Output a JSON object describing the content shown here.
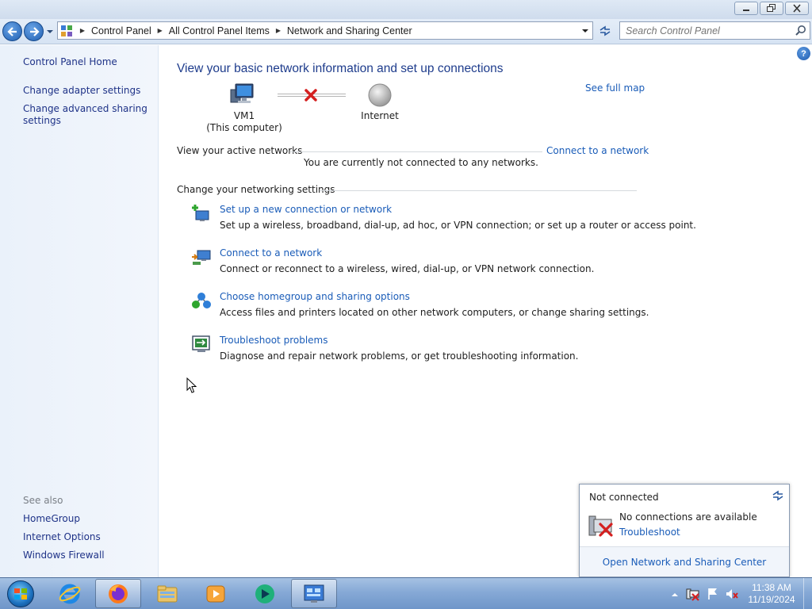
{
  "window": {
    "minimize_label": "—",
    "maximize_label": "❐",
    "close_label": "✕"
  },
  "address": {
    "crumbs": [
      "Control Panel",
      "All Control Panel Items",
      "Network and Sharing Center"
    ],
    "icons": {
      "back": "back-arrow-icon",
      "forward": "forward-arrow-icon",
      "refresh": "refresh-icon",
      "search": "search-icon"
    }
  },
  "search": {
    "placeholder": "Search Control Panel"
  },
  "sidebar": {
    "home": "Control Panel Home",
    "items": [
      "Change adapter settings",
      "Change advanced sharing settings"
    ],
    "see_also_label": "See also",
    "see_also": [
      "HomeGroup",
      "Internet Options",
      "Windows Firewall"
    ]
  },
  "help_label": "?",
  "main": {
    "title": "View your basic network information and set up connections",
    "see_full_map": "See full map",
    "network_map": {
      "computer_name": "VM1",
      "computer_sub": "(This computer)",
      "internet": "Internet",
      "status": "disconnected"
    },
    "active_networks": {
      "heading": "View your active networks",
      "connect_link": "Connect to a network",
      "message": "You are currently not connected to any networks."
    },
    "settings": {
      "heading": "Change your networking settings",
      "tasks": [
        {
          "link": "Set up a new connection or network",
          "desc": "Set up a wireless, broadband, dial-up, ad hoc, or VPN connection; or set up a router or access point.",
          "icon": "new-connection-icon"
        },
        {
          "link": "Connect to a network",
          "desc": "Connect or reconnect to a wireless, wired, dial-up, or VPN network connection.",
          "icon": "connect-network-icon"
        },
        {
          "link": "Choose homegroup and sharing options",
          "desc": "Access files and printers located on other network computers, or change sharing settings.",
          "icon": "homegroup-icon"
        },
        {
          "link": "Troubleshoot problems",
          "desc": "Diagnose and repair network problems, or get troubleshooting information.",
          "icon": "troubleshoot-icon"
        }
      ]
    }
  },
  "flyout": {
    "title": "Not connected",
    "no_connections": "No connections are available",
    "troubleshoot": "Troubleshoot",
    "open_center": "Open Network and Sharing Center"
  },
  "taskbar": {
    "apps": [
      "start-orb",
      "internet-explorer",
      "firefox",
      "windows-explorer",
      "media-player",
      "windows-live",
      "control-panel"
    ],
    "active_app": "control-panel",
    "clock_time": "11:38 AM",
    "clock_date": "11/19/2024"
  },
  "colors": {
    "link": "#1a5cb8",
    "title": "#1e3c8c",
    "sidebar_link": "#1e3287",
    "error_red": "#d42020"
  }
}
